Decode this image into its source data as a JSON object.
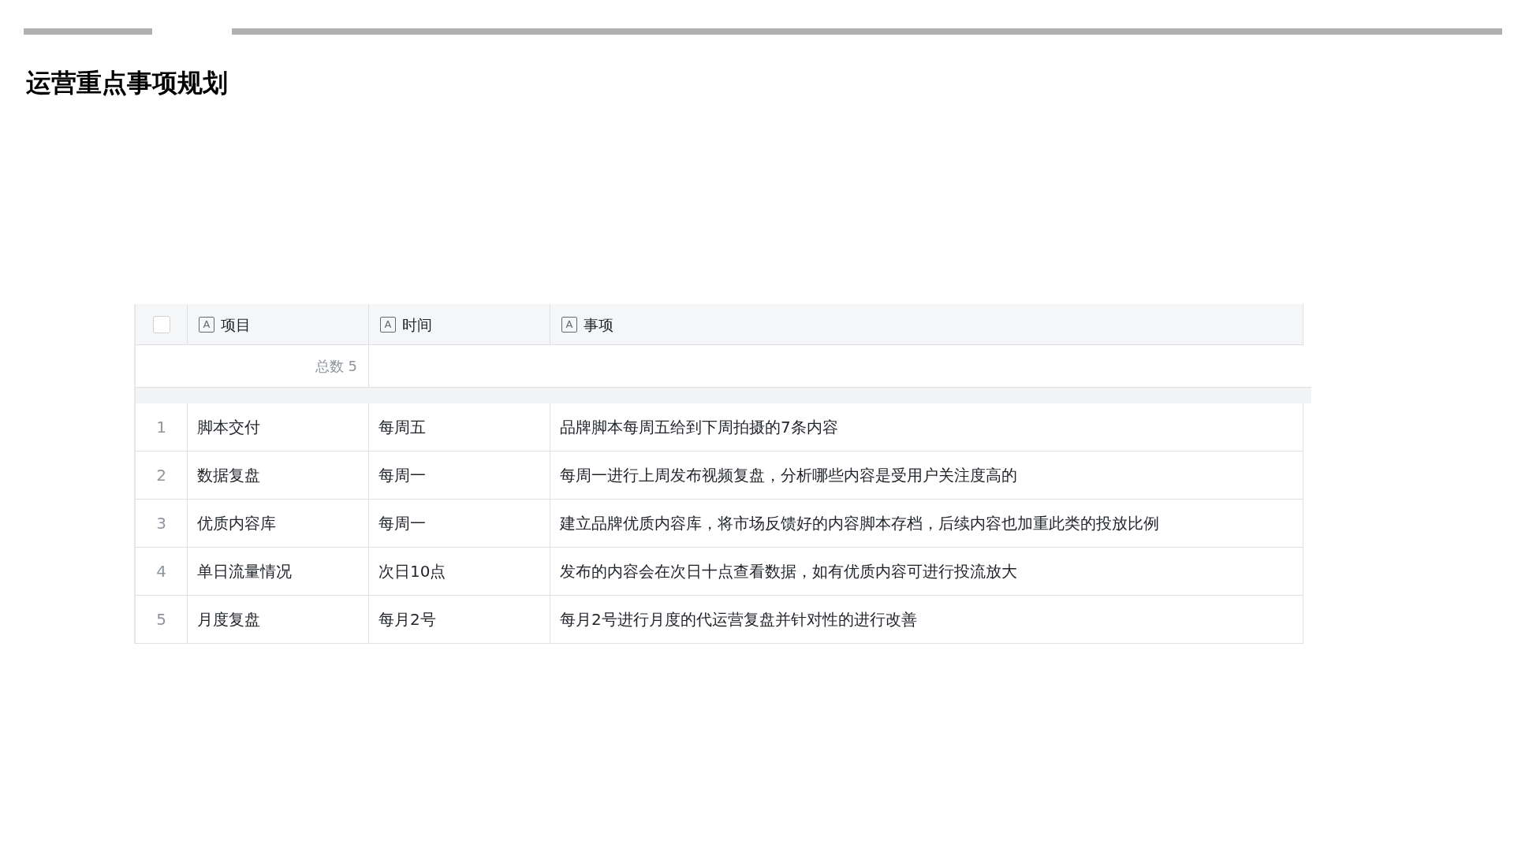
{
  "slide": {
    "title": "运营重点事项规划"
  },
  "table": {
    "select_all": {
      "checked": false
    },
    "columns": [
      {
        "type_glyph": "A",
        "label": "项目"
      },
      {
        "type_glyph": "A",
        "label": "时间"
      },
      {
        "type_glyph": "A",
        "label": "事项"
      }
    ],
    "summary": "总数 5",
    "rows": [
      {
        "index": "1",
        "cells": [
          "脚本交付",
          "每周五",
          "品牌脚本每周五给到下周拍摄的7条内容"
        ]
      },
      {
        "index": "2",
        "cells": [
          "数据复盘",
          "每周一",
          "每周一进行上周发布视频复盘，分析哪些内容是受用户关注度高的"
        ]
      },
      {
        "index": "3",
        "cells": [
          "优质内容库",
          "每周一",
          "建立品牌优质内容库，将市场反馈好的内容脚本存档，后续内容也加重此类的投放比例"
        ]
      },
      {
        "index": "4",
        "cells": [
          "单日流量情况",
          "次日10点",
          "发布的内容会在次日十点查看数据，如有优质内容可进行投流放大"
        ]
      },
      {
        "index": "5",
        "cells": [
          "月度复盘",
          "每月2号",
          "每月2号进行月度的代运营复盘并针对性的进行改善"
        ]
      }
    ]
  }
}
